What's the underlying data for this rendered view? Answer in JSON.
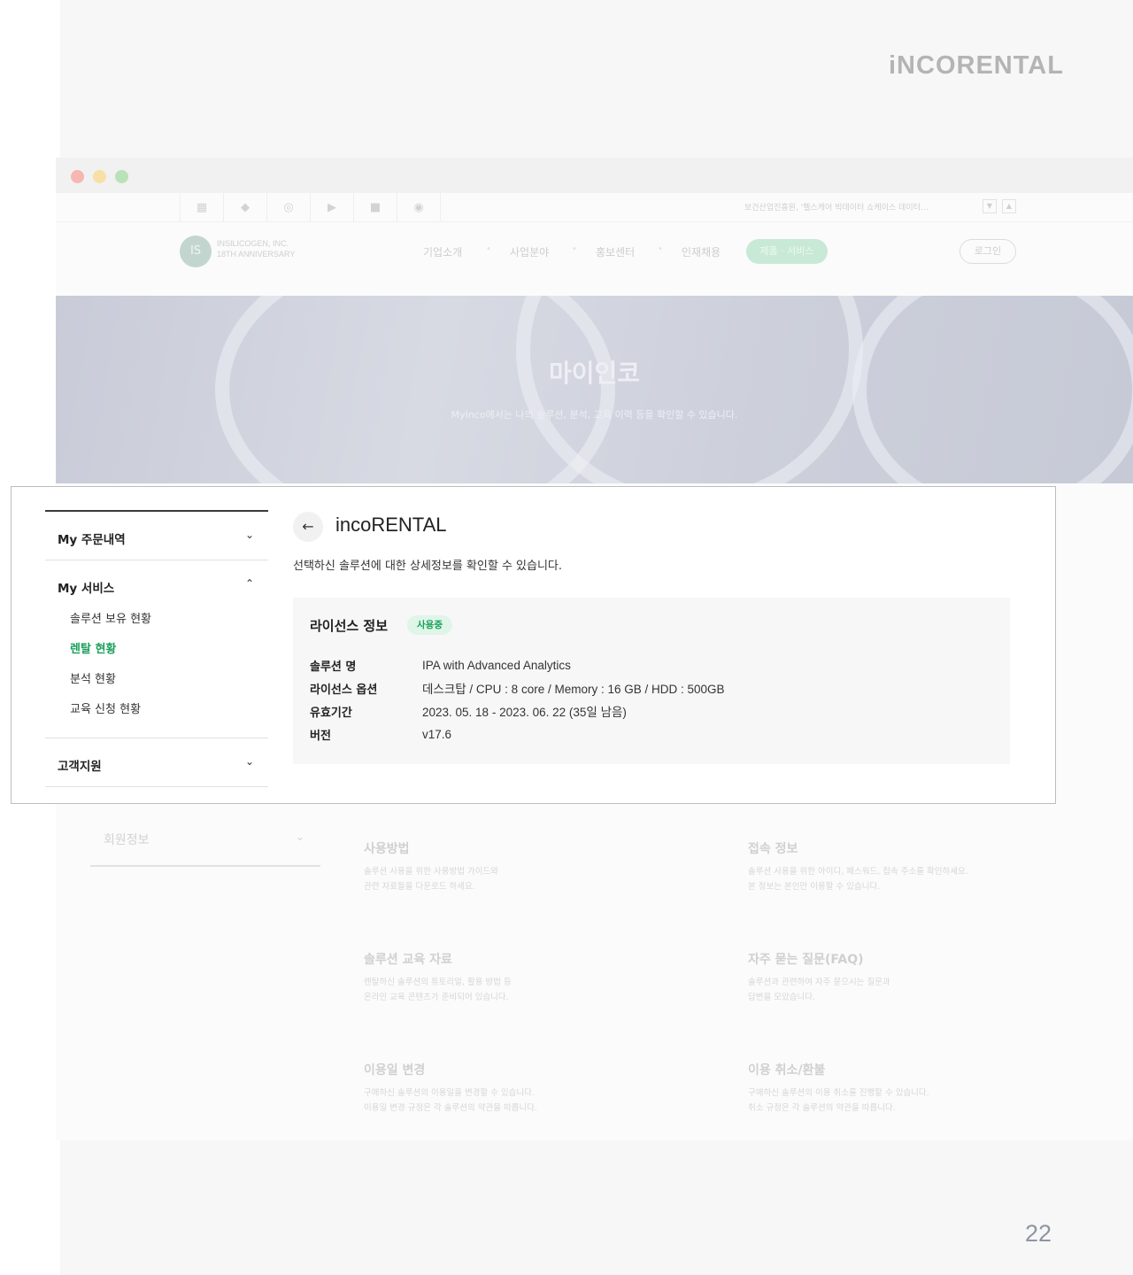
{
  "brand": "iNCORENTAL",
  "page_number": "22",
  "site": {
    "notice": "보건산업진흥원, '헬스케어 빅데이터 쇼케이스 데이터…",
    "logo_line1": "INSILICOGEN, INC.",
    "logo_line2": "18TH ANNIVERSARY",
    "nav": [
      "기업소개",
      "사업분야",
      "홍보센터",
      "인재채용"
    ],
    "nav_active": "제품 · 서비스",
    "login": "로그인"
  },
  "hero": {
    "title": "마이인코",
    "subtitle": "MyInco에서는 나의 솔루션, 분석, 교육 이력 등을 확인할 수 있습니다."
  },
  "sidebar": {
    "orders": "My 주문내역",
    "services": "My 서비스",
    "service_items": [
      "솔루션 보유 현황",
      "렌탈 현황",
      "분석 현황",
      "교육 신청 현황"
    ],
    "support": "고객지원",
    "member": "회원정보"
  },
  "detail": {
    "title": "incoRENTAL",
    "description": "선택하신 솔루션에 대한 상세정보를 확인할 수 있습니다.",
    "license_title": "라이선스 정보",
    "status_badge": "사용중",
    "rows": [
      {
        "label": "솔루션 명",
        "value": "IPA with Advanced Analytics"
      },
      {
        "label": "라이선스 옵션",
        "value": "데스크탑 / CPU : 8 core / Memory : 16 GB / HDD : 500GB"
      },
      {
        "label": "유효기간",
        "value": "2023. 05. 18 - 2023. 06. 22 (35일 남음)"
      },
      {
        "label": "버전",
        "value": "v17.6"
      }
    ]
  },
  "cards": [
    {
      "title": "사용방법",
      "line1": "솔루션 사용을 위한 사용방법 가이드와",
      "line2": "관련 자료들을 다운로드 하세요."
    },
    {
      "title": "접속 정보",
      "line1": "솔루션 사용을 위한 아이디, 패스워드, 접속 주소를 확인하세요.",
      "line2": "본 정보는 본인만 이용할 수 있습니다."
    },
    {
      "title": "솔루션 교육 자료",
      "line1": "렌탈하신 솔루션의 튜토리얼, 활용 방법 등",
      "line2": "온라인 교육 콘텐츠가 준비되어 있습니다."
    },
    {
      "title": "자주 묻는 질문(FAQ)",
      "line1": "솔루션과 관련하여 자주 묻으시는 질문과",
      "line2": "답변을 모았습니다."
    },
    {
      "title": "이용일 변경",
      "line1": "구매하신 솔루션의 이용일을 변경할 수 있습니다.",
      "line2": "이용일 변경 규정은 각 솔루션의 약관을 따릅니다."
    },
    {
      "title": "이용 취소/환불",
      "line1": "구매하신 솔루션의 이용 취소를 진행할 수 있습니다.",
      "line2": "취소 규정은 각 솔루션의 약관을 따릅니다."
    }
  ],
  "colors": {
    "accent": "#19a05a",
    "badge_bg": "#dff5e8"
  }
}
